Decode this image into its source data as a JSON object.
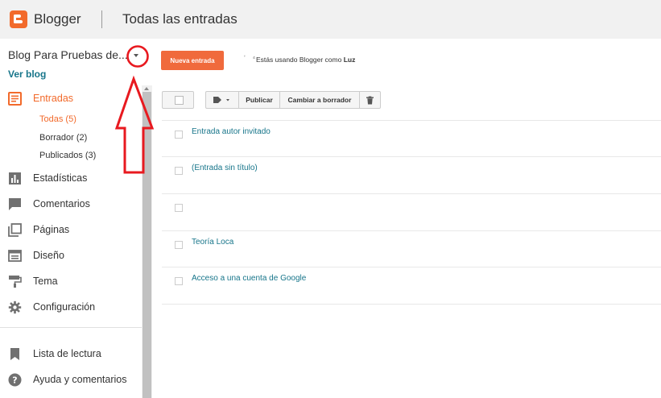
{
  "header": {
    "brand": "Blogger",
    "title": "Todas las entradas",
    "accent": "#f26a2b"
  },
  "sidebar": {
    "blog_name": "Blog Para Pruebas de...",
    "view_blog": "Ver blog",
    "nav": [
      {
        "label": "Entradas",
        "icon": "posts-icon",
        "active": true
      },
      {
        "label": "Estadísticas",
        "icon": "stats-icon"
      },
      {
        "label": "Comentarios",
        "icon": "comments-icon"
      },
      {
        "label": "Páginas",
        "icon": "pages-icon"
      },
      {
        "label": "Diseño",
        "icon": "layout-icon"
      },
      {
        "label": "Tema",
        "icon": "theme-icon"
      },
      {
        "label": "Configuración",
        "icon": "gear-icon"
      }
    ],
    "subnav": [
      {
        "label": "Todas (5)",
        "active": true
      },
      {
        "label": "Borrador (2)"
      },
      {
        "label": "Publicados (3)"
      }
    ],
    "bottom_nav": [
      {
        "label": "Lista de lectura",
        "icon": "bookmark-icon"
      },
      {
        "label": "Ayuda y comentarios",
        "icon": "help-icon"
      }
    ]
  },
  "main": {
    "new_post": "Nueva entrada",
    "using_prefix": "Estás usando Blogger como",
    "user": "Luz",
    "toolbar": {
      "publish": "Publicar",
      "to_draft": "Cambiar a borrador"
    },
    "posts": [
      "Entrada autor invitado",
      "(Entrada sin título)",
      "",
      "Teoría Loca",
      "Acceso a una cuenta de Google"
    ]
  }
}
